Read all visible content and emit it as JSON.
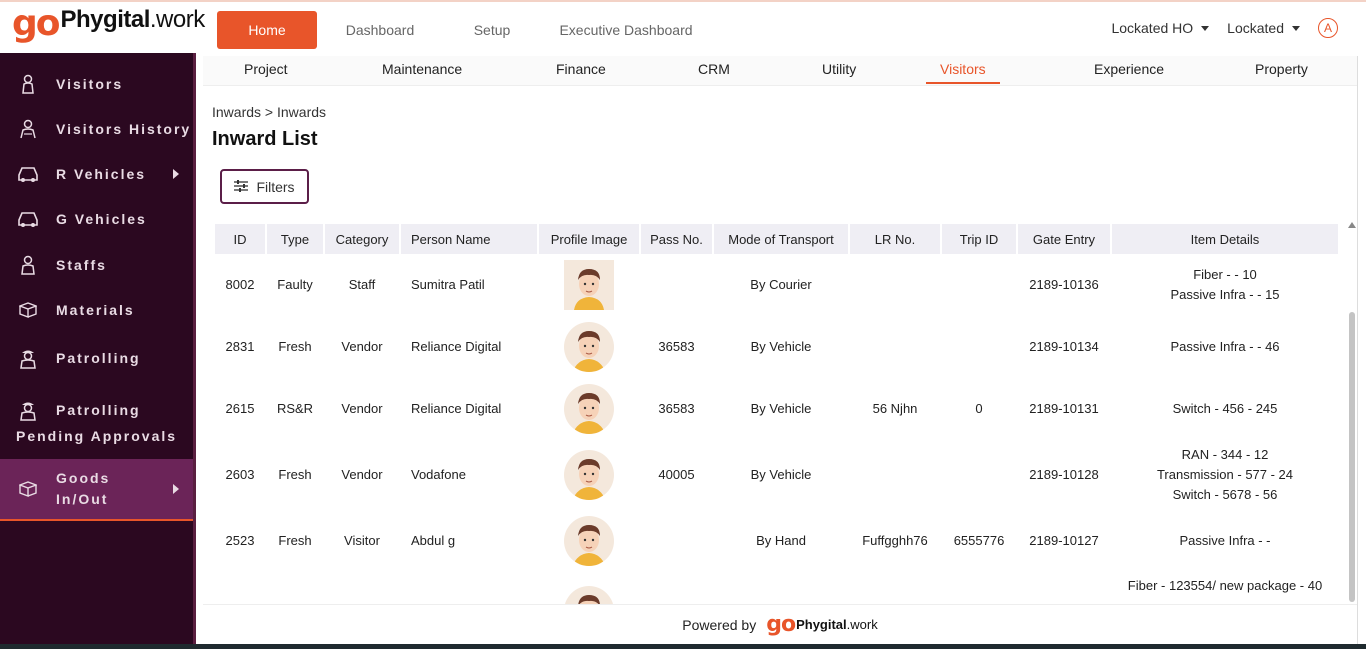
{
  "app": {
    "logo_go": "go",
    "logo_brand": "Phygital",
    "logo_suffix": ".work"
  },
  "topnav": {
    "items": [
      "Home",
      "Dashboard",
      "Setup",
      "Executive Dashboard"
    ],
    "active": "Home"
  },
  "topright": {
    "org": "Lockated HO",
    "user": "Lockated",
    "avatar_letter": "A"
  },
  "sidebar": {
    "items": [
      {
        "label": "Visitors",
        "icon": "visitor-icon"
      },
      {
        "label": "Visitors History",
        "icon": "visitor-history-icon"
      },
      {
        "label": "R Vehicles",
        "icon": "car-icon",
        "has_submenu": true
      },
      {
        "label": "G Vehicles",
        "icon": "car-icon"
      },
      {
        "label": "Staffs",
        "icon": "staff-icon"
      },
      {
        "label": "Materials",
        "icon": "box-icon"
      },
      {
        "label": "Patrolling",
        "icon": "guard-icon"
      },
      {
        "label": "Patrolling",
        "label2": "Pending Approvals",
        "icon": "guard-icon"
      },
      {
        "label": "Goods",
        "label2": "In/Out",
        "icon": "box-icon",
        "has_submenu": true,
        "active": true
      }
    ]
  },
  "subnav": {
    "items": [
      "Project",
      "Maintenance",
      "Finance",
      "CRM",
      "Utility",
      "Visitors",
      "Experience",
      "Property"
    ],
    "active": "Visitors"
  },
  "breadcrumb": {
    "parent": "Inwards",
    "sep": ">",
    "current": "Inwards"
  },
  "page_title": "Inward List",
  "filters_label": "Filters",
  "table": {
    "headers": [
      "ID",
      "Type",
      "Category",
      "Person Name",
      "Profile Image",
      "Pass No.",
      "Mode of Transport",
      "LR No.",
      "Trip ID",
      "Gate Entry",
      "Item Details"
    ],
    "rows": [
      {
        "id": "8002",
        "type": "Faulty",
        "category": "Staff",
        "person": "Sumitra Patil",
        "pass": "",
        "mode": "By Courier",
        "lr": "",
        "trip": "",
        "gate": "2189-10136",
        "items": [
          "Fiber - - 10",
          "Passive Infra - - 15"
        ]
      },
      {
        "id": "2831",
        "type": "Fresh",
        "category": "Vendor",
        "person": "Reliance Digital",
        "pass": "36583",
        "mode": "By Vehicle",
        "lr": "",
        "trip": "",
        "gate": "2189-10134",
        "items": [
          "Passive Infra - - 46"
        ]
      },
      {
        "id": "2615",
        "type": "RS&R",
        "category": "Vendor",
        "person": "Reliance Digital",
        "pass": "36583",
        "mode": "By Vehicle",
        "lr": "56 Njhn",
        "trip": "0",
        "gate": "2189-10131",
        "items": [
          "Switch - 456 - 245"
        ]
      },
      {
        "id": "2603",
        "type": "Fresh",
        "category": "Vendor",
        "person": "Vodafone",
        "pass": "40005",
        "mode": "By Vehicle",
        "lr": "",
        "trip": "",
        "gate": "2189-10128",
        "items": [
          "RAN - 344 - 12",
          "Transmission - 577 - 24",
          "Switch - 5678 - 56"
        ]
      },
      {
        "id": "2523",
        "type": "Fresh",
        "category": "Visitor",
        "person": "Abdul g",
        "pass": "",
        "mode": "By Hand",
        "lr": "Fuffgghh76",
        "trip": "6555776",
        "gate": "2189-10127",
        "items": [
          "Passive Infra - -"
        ]
      },
      {
        "id": "",
        "type": "",
        "category": "",
        "person": "",
        "pass": "",
        "mode": "",
        "lr": "",
        "trip": "",
        "gate": "",
        "items": [
          "Fiber - 123554/ new package - 40"
        ]
      }
    ]
  },
  "footer": {
    "powered_by": "Powered by"
  },
  "colors": {
    "accent": "#e8552a",
    "sidebar_bg": "#2b0820",
    "sidebar_active": "#6b2458"
  }
}
